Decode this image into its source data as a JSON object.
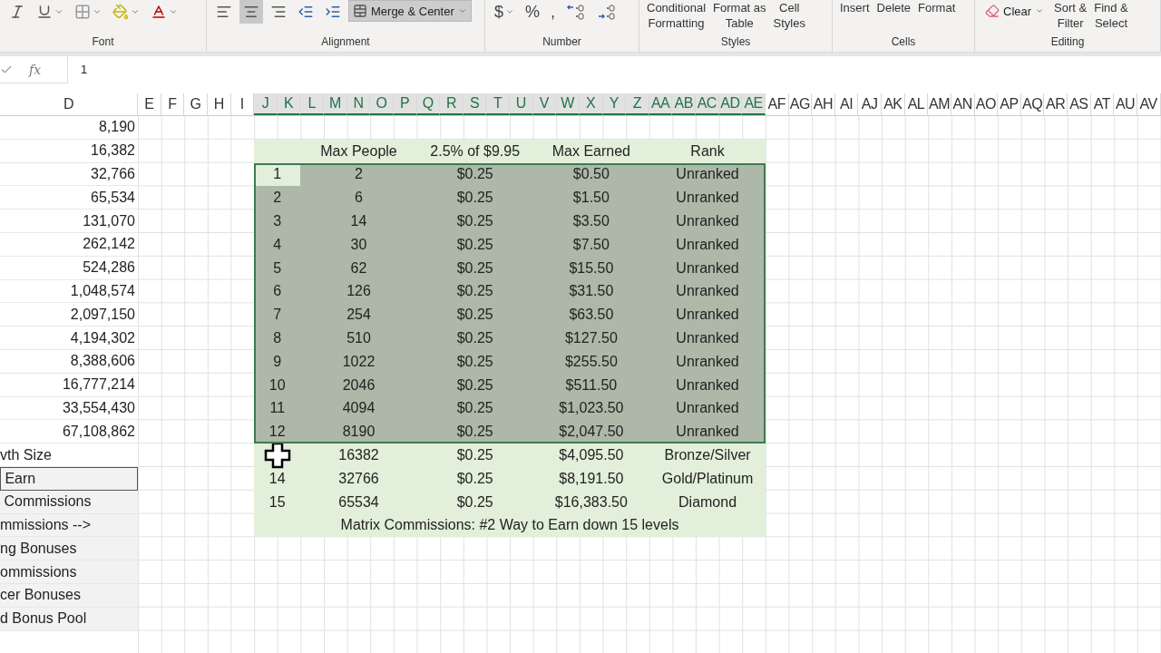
{
  "ribbon": {
    "groups": [
      {
        "label": "Font",
        "items": [
          {
            "kind": "icon"
          },
          {
            "kind": "icon"
          },
          {
            "kind": "icon"
          },
          {
            "kind": "icon"
          },
          {
            "kind": "icon"
          }
        ]
      },
      {
        "label": "Alignment",
        "items": [
          {
            "kind": "icon",
            "selected": false
          },
          {
            "kind": "icon",
            "selected": true
          },
          {
            "kind": "icon",
            "selected": false
          },
          {
            "kind": "icon",
            "selected": false
          },
          {
            "kind": "icon",
            "selected": false
          },
          {
            "kind": "wide",
            "label": "Merge & Center",
            "selected": true
          }
        ]
      },
      {
        "label": "Number",
        "items": [
          {
            "kind": "symbol",
            "label": "$"
          },
          {
            "kind": "symbol",
            "label": "%"
          },
          {
            "kind": "symbol",
            "label": ","
          },
          {
            "kind": "icon"
          },
          {
            "kind": "icon"
          }
        ]
      },
      {
        "label": "Styles",
        "items": [
          {
            "kind": "stack",
            "lines": [
              "Conditional",
              "Formatting"
            ]
          },
          {
            "kind": "stack",
            "lines": [
              "Format as",
              "Table"
            ]
          },
          {
            "kind": "stack",
            "lines": [
              "Cell",
              "Styles"
            ]
          }
        ]
      },
      {
        "label": "Cells",
        "items": [
          {
            "kind": "stack",
            "lines": [
              "Insert"
            ]
          },
          {
            "kind": "stack",
            "lines": [
              "Delete"
            ]
          },
          {
            "kind": "stack",
            "lines": [
              "Format"
            ]
          }
        ]
      },
      {
        "label": "Editing",
        "items": [
          {
            "kind": "clear",
            "label": "Clear"
          },
          {
            "kind": "stack",
            "lines": [
              "Sort &",
              "Filter"
            ]
          },
          {
            "kind": "stack",
            "lines": [
              "Find &",
              "Select"
            ]
          }
        ]
      }
    ]
  },
  "formula_bar": {
    "fx_label": "fx",
    "value": "1"
  },
  "columns": [
    {
      "label": "D",
      "selected": false
    },
    {
      "label": "E",
      "selected": false
    },
    {
      "label": "F",
      "selected": false
    },
    {
      "label": "G",
      "selected": false
    },
    {
      "label": "H",
      "selected": false
    },
    {
      "label": "I",
      "selected": false
    },
    {
      "label": "J",
      "selected": true
    },
    {
      "label": "K",
      "selected": true
    },
    {
      "label": "L",
      "selected": true
    },
    {
      "label": "M",
      "selected": true
    },
    {
      "label": "N",
      "selected": true
    },
    {
      "label": "O",
      "selected": true
    },
    {
      "label": "P",
      "selected": true
    },
    {
      "label": "Q",
      "selected": true
    },
    {
      "label": "R",
      "selected": true
    },
    {
      "label": "S",
      "selected": true
    },
    {
      "label": "T",
      "selected": true
    },
    {
      "label": "U",
      "selected": true
    },
    {
      "label": "V",
      "selected": true
    },
    {
      "label": "W",
      "selected": true
    },
    {
      "label": "X",
      "selected": true
    },
    {
      "label": "Y",
      "selected": true
    },
    {
      "label": "Z",
      "selected": true
    },
    {
      "label": "AA",
      "selected": true
    },
    {
      "label": "AB",
      "selected": true
    },
    {
      "label": "AC",
      "selected": true
    },
    {
      "label": "AD",
      "selected": true
    },
    {
      "label": "AE",
      "selected": true
    },
    {
      "label": "AF",
      "selected": false
    },
    {
      "label": "AG",
      "selected": false
    },
    {
      "label": "AH",
      "selected": false
    },
    {
      "label": "AI",
      "selected": false
    },
    {
      "label": "AJ",
      "selected": false
    },
    {
      "label": "AK",
      "selected": false
    },
    {
      "label": "AL",
      "selected": false
    },
    {
      "label": "AM",
      "selected": false
    },
    {
      "label": "AN",
      "selected": false
    },
    {
      "label": "AO",
      "selected": false
    },
    {
      "label": "AP",
      "selected": false
    },
    {
      "label": "AQ",
      "selected": false
    },
    {
      "label": "AR",
      "selected": false
    },
    {
      "label": "AS",
      "selected": false
    },
    {
      "label": "AT",
      "selected": false
    },
    {
      "label": "AU",
      "selected": false
    },
    {
      "label": "AV",
      "selected": false
    }
  ],
  "column_d": [
    {
      "kind": "number",
      "text": "8,190"
    },
    {
      "kind": "number",
      "text": "16,382"
    },
    {
      "kind": "number",
      "text": "32,766"
    },
    {
      "kind": "number",
      "text": "65,534"
    },
    {
      "kind": "number",
      "text": "131,070"
    },
    {
      "kind": "number",
      "text": "262,142"
    },
    {
      "kind": "number",
      "text": "524,286"
    },
    {
      "kind": "number",
      "text": "1,048,574"
    },
    {
      "kind": "number",
      "text": "2,097,150"
    },
    {
      "kind": "number",
      "text": "4,194,302"
    },
    {
      "kind": "number",
      "text": "8,388,606"
    },
    {
      "kind": "number",
      "text": "16,777,214"
    },
    {
      "kind": "number",
      "text": "33,554,430"
    },
    {
      "kind": "number",
      "text": "67,108,862"
    },
    {
      "kind": "label",
      "text": "vth Size",
      "shaded": false,
      "outlined": false
    },
    {
      "kind": "label",
      "text": " Earn",
      "shaded": true,
      "outlined": true
    },
    {
      "kind": "label",
      "text": " Commissions",
      "shaded": true,
      "outlined": false
    },
    {
      "kind": "label",
      "text": "mmissions -->",
      "shaded": true,
      "outlined": false
    },
    {
      "kind": "label",
      "text": "ng Bonuses",
      "shaded": true,
      "outlined": false
    },
    {
      "kind": "label",
      "text": "ommissions",
      "shaded": true,
      "outlined": false
    },
    {
      "kind": "label",
      "text": "cer Bonuses",
      "shaded": true,
      "outlined": false
    },
    {
      "kind": "label",
      "text": "d Bonus Pool",
      "shaded": true,
      "outlined": false
    }
  ],
  "table": {
    "columns": [
      "Max People",
      "2.5% of $9.95",
      "Max Earned",
      "Rank"
    ],
    "rows": [
      {
        "n": "1",
        "people": "2",
        "rate": "$0.25",
        "earned": "$0.50",
        "rank": "Unranked",
        "selected": true,
        "active": true
      },
      {
        "n": "2",
        "people": "6",
        "rate": "$0.25",
        "earned": "$1.50",
        "rank": "Unranked",
        "selected": true
      },
      {
        "n": "3",
        "people": "14",
        "rate": "$0.25",
        "earned": "$3.50",
        "rank": "Unranked",
        "selected": true
      },
      {
        "n": "4",
        "people": "30",
        "rate": "$0.25",
        "earned": "$7.50",
        "rank": "Unranked",
        "selected": true
      },
      {
        "n": "5",
        "people": "62",
        "rate": "$0.25",
        "earned": "$15.50",
        "rank": "Unranked",
        "selected": true
      },
      {
        "n": "6",
        "people": "126",
        "rate": "$0.25",
        "earned": "$31.50",
        "rank": "Unranked",
        "selected": true
      },
      {
        "n": "7",
        "people": "254",
        "rate": "$0.25",
        "earned": "$63.50",
        "rank": "Unranked",
        "selected": true
      },
      {
        "n": "8",
        "people": "510",
        "rate": "$0.25",
        "earned": "$127.50",
        "rank": "Unranked",
        "selected": true
      },
      {
        "n": "9",
        "people": "1022",
        "rate": "$0.25",
        "earned": "$255.50",
        "rank": "Unranked",
        "selected": true
      },
      {
        "n": "10",
        "people": "2046",
        "rate": "$0.25",
        "earned": "$511.50",
        "rank": "Unranked",
        "selected": true
      },
      {
        "n": "11",
        "people": "4094",
        "rate": "$0.25",
        "earned": "$1,023.50",
        "rank": "Unranked",
        "selected": true
      },
      {
        "n": "12",
        "people": "8190",
        "rate": "$0.25",
        "earned": "$2,047.50",
        "rank": "Unranked",
        "selected": true
      },
      {
        "people": "16382",
        "rate": "$0.25",
        "earned": "$4,095.50",
        "rank": "Bronze/Silver",
        "selected": false
      },
      {
        "n": "14",
        "people": "32766",
        "rate": "$0.25",
        "earned": "$8,191.50",
        "rank": "Gold/Platinum",
        "selected": false
      },
      {
        "n": "15",
        "people": "65534",
        "rate": "$0.25",
        "earned": "$16,383.50",
        "rank": "Diamond",
        "selected": false
      }
    ],
    "footer": "Matrix Commissions: #2 Way to Earn down 15 levels"
  }
}
